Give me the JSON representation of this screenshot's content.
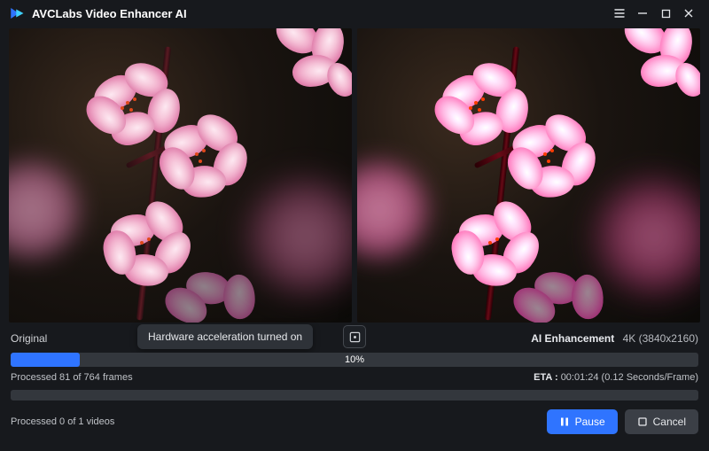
{
  "app": {
    "title": "AVCLabs Video Enhancer AI"
  },
  "preview": {
    "left_label": "Original",
    "right_label": "AI Enhancement",
    "resolution": "4K (3840x2160)",
    "tooltip": "Hardware acceleration turned on"
  },
  "progress": {
    "frames": {
      "percent_text": "10%",
      "percent_value": 10,
      "processed_text": "Processed 81 of 764 frames",
      "eta_label": "ETA :",
      "eta_value": "00:01:24 (0.12 Seconds/Frame)"
    },
    "videos": {
      "percent_value": 0,
      "processed_text": "Processed 0 of 1 videos"
    }
  },
  "buttons": {
    "pause": "Pause",
    "cancel": "Cancel"
  },
  "colors": {
    "accent": "#2f74ff",
    "bg": "#17191d"
  }
}
